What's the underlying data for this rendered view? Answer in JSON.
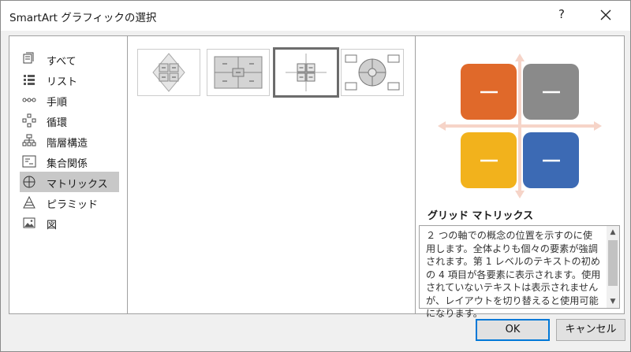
{
  "window": {
    "title": "SmartArt グラフィックの選択",
    "help_label": "?"
  },
  "sidebar": {
    "items": [
      {
        "label": "すべて",
        "icon": "all-icon"
      },
      {
        "label": "リスト",
        "icon": "list-icon"
      },
      {
        "label": "手順",
        "icon": "process-icon"
      },
      {
        "label": "循環",
        "icon": "cycle-icon"
      },
      {
        "label": "階層構造",
        "icon": "hierarchy-icon"
      },
      {
        "label": "集合関係",
        "icon": "relationship-icon"
      },
      {
        "label": "マトリックス",
        "icon": "matrix-icon",
        "selected": true
      },
      {
        "label": "ピラミッド",
        "icon": "pyramid-icon"
      },
      {
        "label": "図",
        "icon": "picture-icon"
      }
    ]
  },
  "gallery": {
    "selected_index": 2,
    "layouts": [
      "basic-matrix",
      "titled-matrix",
      "grid-matrix",
      "cycle-matrix"
    ]
  },
  "preview": {
    "name": "グリッド マトリックス",
    "description": "２ つの軸での概念の位置を示すのに使用します。全体よりも個々の要素が強調されます。第 1 レベルのテキストの初めの 4 項目が各要素に表示されます。使用されていないテキストは表示されませんが、レイアウトを切り替えると使用可能になります。",
    "box_colors": [
      "#e0692a",
      "#8a8a8a",
      "#f2b21c",
      "#3c6ab4"
    ],
    "box_text": "—"
  },
  "buttons": {
    "ok": "OK",
    "cancel": "キャンセル"
  }
}
